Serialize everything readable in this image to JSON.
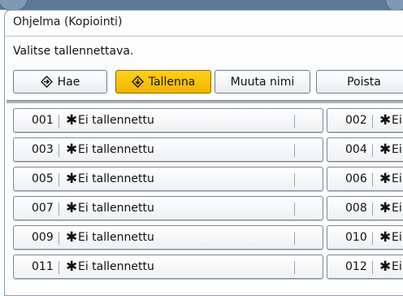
{
  "window": {
    "title": "Ohjelma (Kopiointi)"
  },
  "instruction": "Valitse tallennettava.",
  "toolbar": {
    "recall_label": "Hae",
    "recall_icon": "program-recall-icon",
    "store_label": "Tallenna",
    "store_icon": "program-store-icon",
    "rename_label": "Muuta nimi",
    "delete_label": "Poista",
    "active": "store",
    "accent_color": "#f5be0a"
  },
  "star_glyph": "✱",
  "programs": [
    {
      "number": "001",
      "label": "Ei tallennettu"
    },
    {
      "number": "002",
      "label": "Ei"
    },
    {
      "number": "003",
      "label": "Ei tallennettu"
    },
    {
      "number": "004",
      "label": "Ei"
    },
    {
      "number": "005",
      "label": "Ei tallennettu"
    },
    {
      "number": "006",
      "label": "Ei"
    },
    {
      "number": "007",
      "label": "Ei tallennettu"
    },
    {
      "number": "008",
      "label": "Ei"
    },
    {
      "number": "009",
      "label": "Ei tallennettu"
    },
    {
      "number": "010",
      "label": "Ei"
    },
    {
      "number": "011",
      "label": "Ei tallennettu"
    },
    {
      "number": "012",
      "label": "Ei"
    }
  ]
}
